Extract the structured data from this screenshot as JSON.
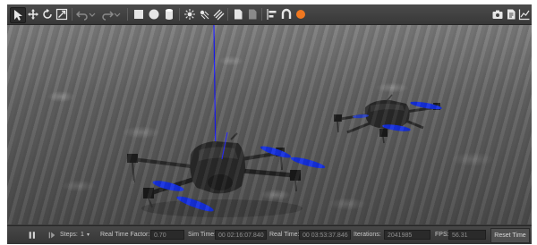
{
  "toolbar": {
    "left_icons": [
      "arrow-select-icon",
      "translate-icon",
      "rotate-icon",
      "scale-icon",
      "undo-icon",
      "undo-dropdown-icon",
      "redo-icon",
      "redo-dropdown-icon",
      "box-shape-icon",
      "sphere-shape-icon",
      "cylinder-shape-icon",
      "point-light-icon",
      "spot-light-icon",
      "directional-light-icon",
      "copy-icon",
      "paste-icon",
      "align-icon",
      "snap-icon",
      "audio-icon",
      "record-icon"
    ],
    "right_icons": [
      "screenshot-icon",
      "log-icon",
      "plot-icon"
    ],
    "accent_color": "#f07820"
  },
  "status": {
    "steps_label": "Steps:",
    "steps_value": "1",
    "rtf_label": "Real Time Factor:",
    "rtf_value": "0.70",
    "sim_time_label": "Sim Time:",
    "sim_time_value": "00 02:16:07.840",
    "real_time_label": "Real Time:",
    "real_time_value": "00 03:53:37.846",
    "iterations_label": "Iterations:",
    "iterations_value": "2041985",
    "fps_label": "FPS:",
    "fps_value": "56.31",
    "reset_label": "Reset Time"
  },
  "scene": {
    "ground": "gravel-ground",
    "axis_color": "#1a1aff",
    "propeller_color": "#1530e0"
  }
}
